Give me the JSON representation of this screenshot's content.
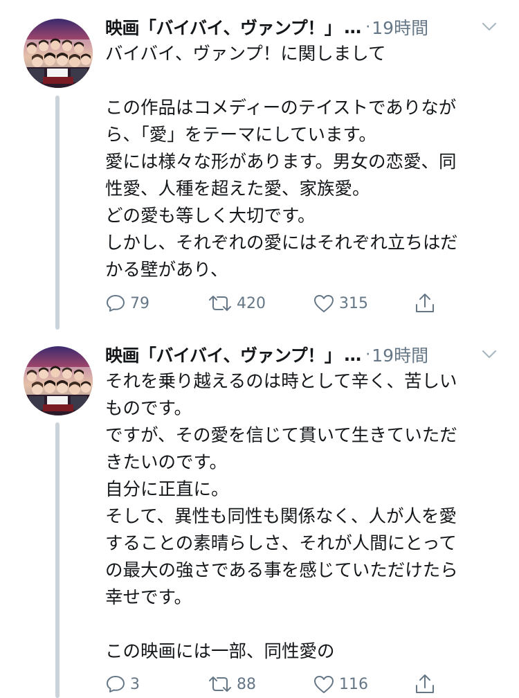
{
  "tweets": [
    {
      "display_name": "映画「バイバイ、ヴァンプ！」",
      "ellipsis": "…",
      "separator": "·",
      "time": "19時間",
      "lines": [
        "バイバイ、ヴァンプ！に関しまして",
        "",
        "この作品はコメディーのテイストでありなが",
        "ら、「愛」をテーマにしています。",
        "愛には様々な形があります。男女の恋愛、同",
        "性愛、人種を超えた愛、家族愛。",
        "どの愛も等しく大切です。",
        "しかし、それぞれの愛にはそれぞれ立ちはだ",
        "かる壁があり、"
      ],
      "replies": "79",
      "retweets": "420",
      "likes": "315"
    },
    {
      "display_name": "映画「バイバイ、ヴァンプ！」",
      "ellipsis": "…",
      "separator": "·",
      "time": "19時間",
      "lines": [
        "それを乗り越えるのは時として辛く、苦しい",
        "ものです。",
        "ですが、その愛を信じて貫いて生きていただ",
        "きたいのです。",
        "自分に正直に。",
        "そして、異性も同性も関係なく、人が人を愛",
        "することの素晴らしさ、それが人間にとって",
        "の最大の強さである事を感じていただけたら",
        "幸せです。",
        "",
        "この映画には一部、同性愛の"
      ],
      "replies": "3",
      "retweets": "88",
      "likes": "116"
    }
  ],
  "icons": {
    "reply": "reply-icon",
    "retweet": "retweet-icon",
    "like": "heart-icon",
    "share": "share-icon",
    "menu": "chevron-down-icon"
  },
  "colors": {
    "text": "#14171a",
    "secondary": "#657786",
    "thread_line": "#cbd3da"
  }
}
